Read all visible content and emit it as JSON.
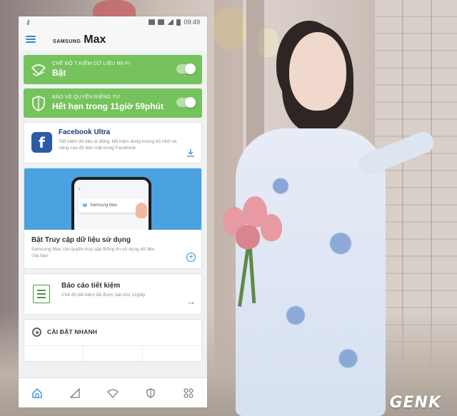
{
  "status_bar": {
    "time": "09:49"
  },
  "app": {
    "brand_prefix": "SAMSUNG",
    "brand_name": "Max"
  },
  "cards": {
    "wifi_saving": {
      "label": "CHẾ ĐỘ T.KIỆM DỮ LIỆU WI-FI",
      "value": "Bật",
      "toggle_on": true
    },
    "privacy": {
      "label": "BẢO VỆ QUYỀN RIÊNG TƯ",
      "value": "Hết hạn trong 11giờ 59phút",
      "toggle_on": true
    },
    "facebook": {
      "title": "Facebook Ultra",
      "description": "Tiết kiệm dữ liệu di động, tiết kiệm dung lượng bộ nhớ và nâng cao độ bảo mật trong Facebook."
    },
    "usage_access": {
      "banner_app_name": "Samsung Max",
      "title": "Bật Truy cập dữ liệu sử dụng",
      "description": "Samsung Max cần quyền truy cập thông tin sử dụng dữ liệu của bạn."
    },
    "report": {
      "title": "Báo cáo tiết kiệm",
      "description": "Chế độ tiết kiệm đã được bật cho 12giây"
    },
    "quick_settings": {
      "title": "CÀI ĐẶT NHANH"
    }
  },
  "bottom_nav": [
    {
      "icon": "home-icon"
    },
    {
      "icon": "data-icon"
    },
    {
      "icon": "wifi-icon"
    },
    {
      "icon": "shield-icon"
    },
    {
      "icon": "apps-icon"
    }
  ],
  "colors": {
    "accent": "#2b8bd1",
    "green": "#76c25d",
    "facebook": "#2e59a8"
  },
  "watermark": "GENK"
}
